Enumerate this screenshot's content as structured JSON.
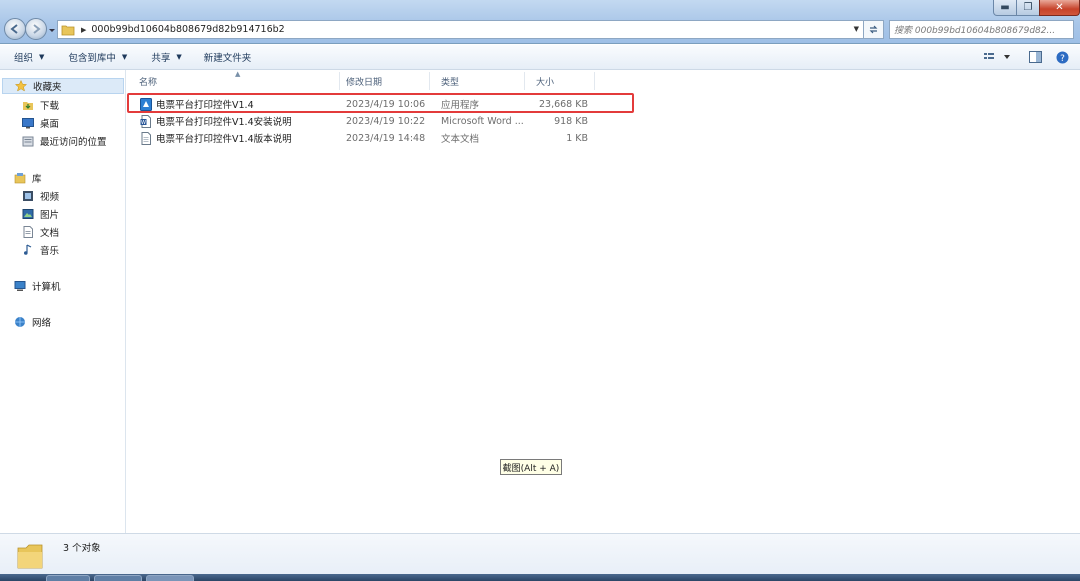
{
  "address_bar": {
    "path": "000b99bd10604b808679d82b914716b2",
    "search_placeholder": "搜索 000b99bd10604b808679d82..."
  },
  "command_bar": {
    "organize": "组织",
    "include_in_library": "包含到库中",
    "share": "共享",
    "new_folder": "新建文件夹"
  },
  "sidebar": {
    "favorites": "收藏夹",
    "downloads": "下载",
    "desktop": "桌面",
    "recent_places": "最近访问的位置",
    "libraries": "库",
    "videos": "视频",
    "pictures": "图片",
    "documents": "文档",
    "music": "音乐",
    "computer": "计算机",
    "network": "网络"
  },
  "columns": {
    "name": "名称",
    "date_modified": "修改日期",
    "type": "类型",
    "size": "大小"
  },
  "files": [
    {
      "name": "电票平台打印控件V1.4",
      "date": "2023/4/19 10:06",
      "type": "应用程序",
      "size": "23,668 KB",
      "icon": "application-icon"
    },
    {
      "name": "电票平台打印控件V1.4安装说明",
      "date": "2023/4/19 10:22",
      "type": "Microsoft Word ...",
      "size": "918 KB",
      "icon": "word-document-icon"
    },
    {
      "name": "电票平台打印控件V1.4版本说明",
      "date": "2023/4/19 14:48",
      "type": "文本文档",
      "size": "1 KB",
      "icon": "text-document-icon"
    }
  ],
  "tooltip": "截图(Alt + A)",
  "status": {
    "item_count": "3 个对象"
  },
  "colors": {
    "highlight": "#e33b3b",
    "titlebar": "#a9c6e8",
    "link_text": "#1e395b"
  }
}
